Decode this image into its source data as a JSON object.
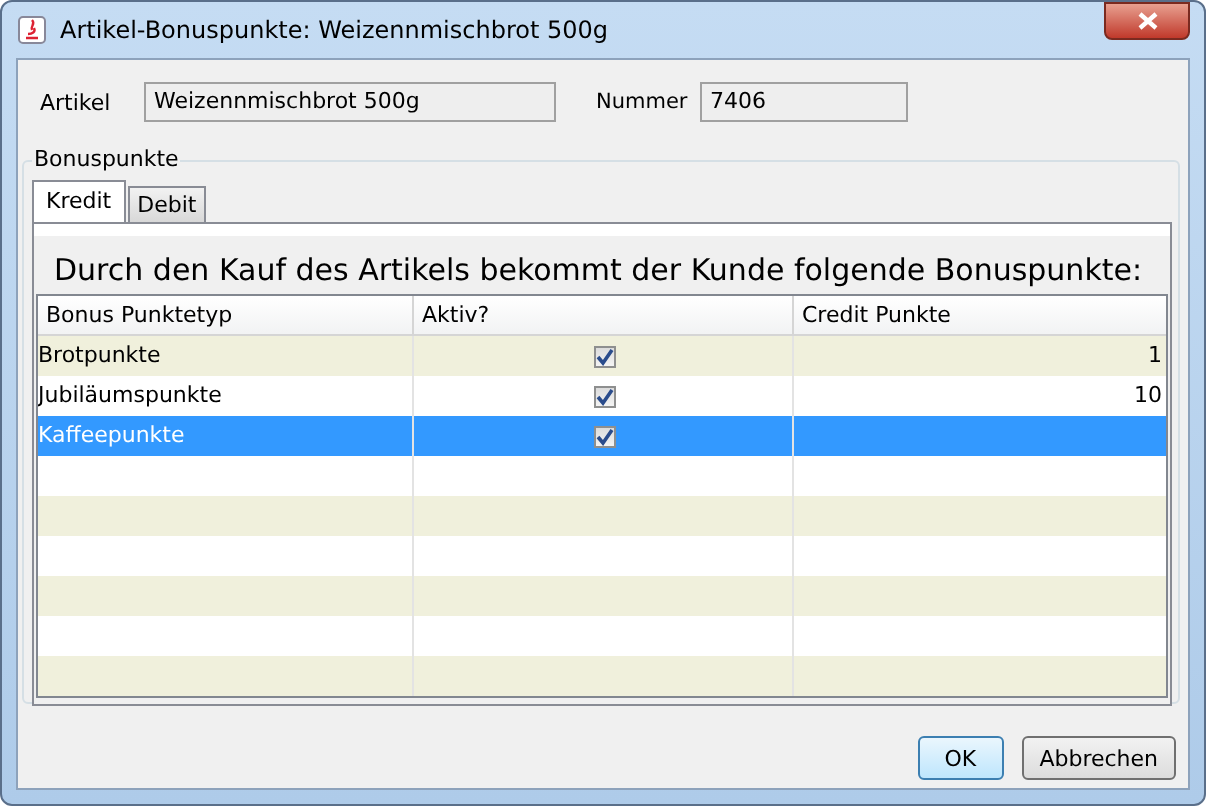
{
  "window": {
    "title": "Artikel-Bonuspunkte: Weizennmischbrot 500g"
  },
  "fields": [
    {
      "label": "Artikel",
      "value": "Weizennmischbrot 500g"
    },
    {
      "label": "Nummer",
      "value": "7406"
    }
  ],
  "group": {
    "title": "Bonuspunkte"
  },
  "tabs": [
    {
      "label": "Kredit",
      "selected": true
    },
    {
      "label": "Debit",
      "selected": false
    }
  ],
  "heading": "Durch den Kauf des Artikels bekommt der Kunde folgende Bonuspunkte:",
  "table": {
    "columns": [
      "Bonus Punktetyp",
      "Aktiv?",
      "Credit Punkte"
    ],
    "rows": [
      {
        "name": "Brotpunkte",
        "active": true,
        "points": "1",
        "selected": false
      },
      {
        "name": "Jubiläumspunkte",
        "active": true,
        "points": "10",
        "selected": false
      },
      {
        "name": "Kaffeepunkte",
        "active": true,
        "selected": true
      }
    ]
  },
  "buttons": [
    {
      "label": "OK",
      "default": true
    },
    {
      "label": "Abbrechen",
      "default": false
    }
  ]
}
